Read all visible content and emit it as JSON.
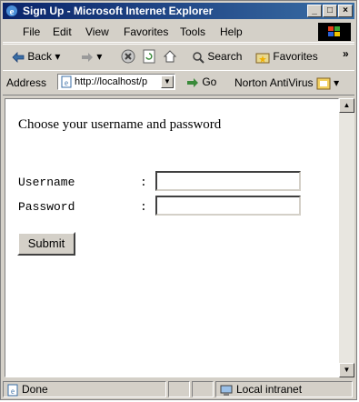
{
  "window": {
    "title": "Sign Up - Microsoft Internet Explorer"
  },
  "menu": {
    "items": [
      "File",
      "Edit",
      "View",
      "Favorites",
      "Tools",
      "Help"
    ]
  },
  "toolbar": {
    "back_label": "Back",
    "search_label": "Search",
    "favorites_label": "Favorites",
    "chevron": "»"
  },
  "address": {
    "label": "Address",
    "url": "http://localhost/p",
    "go_label": "Go",
    "norton_label": "Norton AntiVirus"
  },
  "page": {
    "heading": "Choose your username and password",
    "username_label": "Username",
    "password_label": "Password",
    "colon": ":",
    "username_value": "",
    "password_value": "",
    "submit_label": "Submit"
  },
  "status": {
    "text": "Done",
    "zone": "Local intranet"
  }
}
